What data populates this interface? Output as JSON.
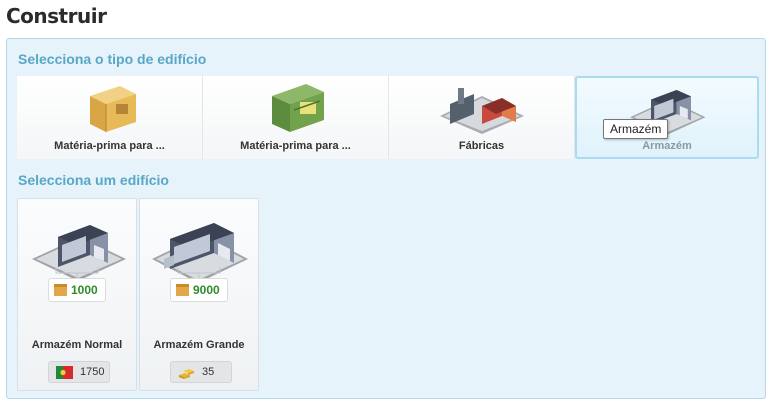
{
  "page_title": "Construir",
  "section_type": "Selecciona o tipo de edifício",
  "section_building": "Selecciona um edifício",
  "categories": [
    {
      "label": "Matéria-prima para ...",
      "icon": "cardboard-box-icon"
    },
    {
      "label": "Matéria-prima para ...",
      "icon": "green-crate-icon"
    },
    {
      "label": "Fábricas",
      "icon": "factory-icon"
    },
    {
      "label": "Armazém",
      "icon": "warehouse-icon",
      "selected": true
    }
  ],
  "tooltip": "Armazém",
  "buildings": [
    {
      "name": "Armazém Normal",
      "capacity": "1000",
      "cost": "1750",
      "cost_icon": "portugal-flag-icon",
      "icon": "warehouse-icon"
    },
    {
      "name": "Armazém Grande",
      "capacity": "9000",
      "cost": "35",
      "cost_icon": "gold-bars-icon",
      "icon": "large-warehouse-icon"
    }
  ],
  "colors": {
    "panel_bg": "#e6f3fa",
    "section_title": "#58a7c8",
    "capacity_text": "#2e8b2a"
  }
}
